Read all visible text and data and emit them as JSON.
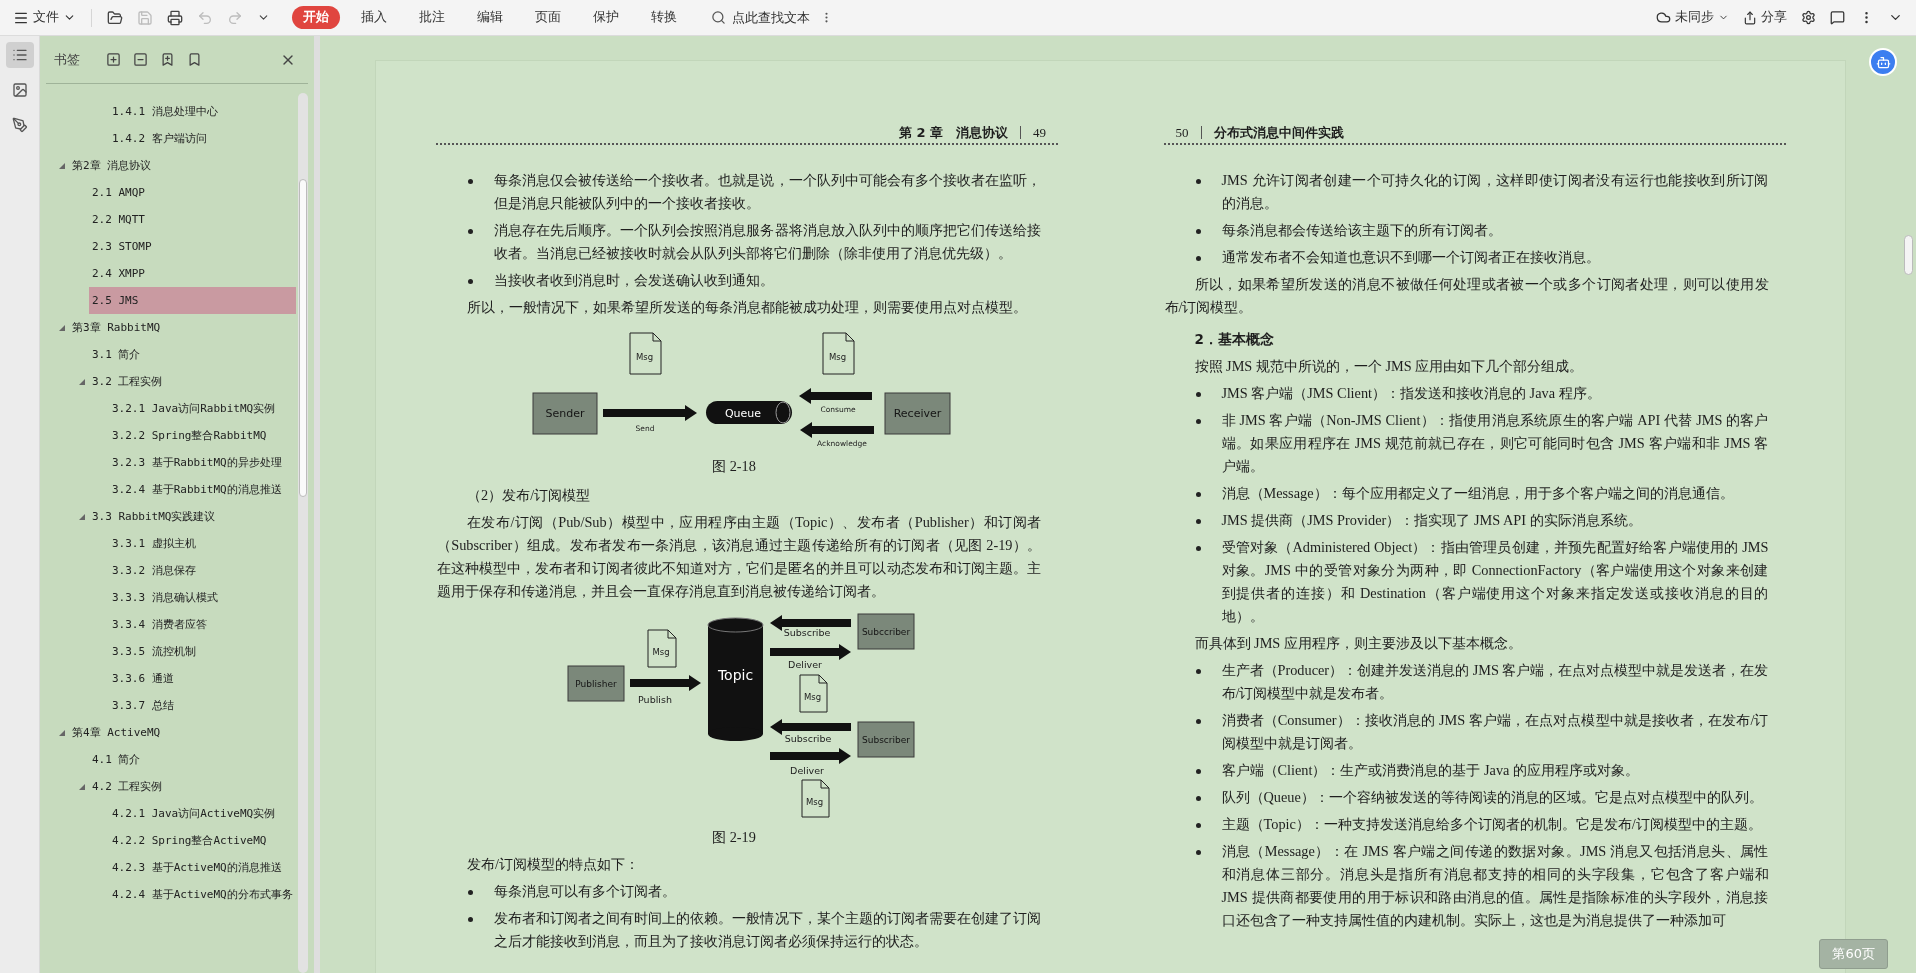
{
  "toolbar": {
    "file_menu": "文件",
    "quick_actions": [
      {
        "kind": "open",
        "disabled": false
      },
      {
        "kind": "save",
        "disabled": true
      },
      {
        "kind": "print",
        "disabled": false
      },
      {
        "kind": "undo",
        "disabled": true
      },
      {
        "kind": "redo",
        "disabled": true
      },
      {
        "kind": "more",
        "disabled": false
      }
    ],
    "tabs": [
      {
        "label": "开始",
        "selected": true
      },
      {
        "label": "插入",
        "selected": false
      },
      {
        "label": "批注",
        "selected": false
      },
      {
        "label": "编辑",
        "selected": false
      },
      {
        "label": "页面",
        "selected": false
      },
      {
        "label": "保护",
        "selected": false
      },
      {
        "label": "转换",
        "selected": false
      }
    ],
    "search": {
      "placeholder": "点此查找文本"
    },
    "sync": "未同步",
    "share": "分享"
  },
  "rail": [
    {
      "kind": "outline",
      "selected": true
    },
    {
      "kind": "images",
      "selected": false
    },
    {
      "kind": "sign",
      "selected": false
    }
  ],
  "bookmarks": {
    "title": "书签",
    "items": [
      {
        "children": [
          {
            "children": [
              {
                "label": "1.4.1 消息处理中心",
                "selected": false
              },
              {
                "label": "1.4.2 客户端访问",
                "selected": false
              }
            ]
          }
        ]
      },
      {
        "label": "第2章 消息协议",
        "expanded": true,
        "selected": false,
        "children": [
          {
            "label": "2.1 AMQP",
            "selected": false
          },
          {
            "label": "2.2 MQTT",
            "selected": false
          },
          {
            "label": "2.3 STOMP",
            "selected": false
          },
          {
            "label": "2.4 XMPP",
            "selected": false
          },
          {
            "label": "2.5 JMS",
            "selected": true
          }
        ]
      },
      {
        "label": "第3章 RabbitMQ",
        "expanded": true,
        "selected": false,
        "children": [
          {
            "label": "3.1 简介",
            "selected": false
          },
          {
            "label": "3.2 工程实例",
            "expanded": true,
            "selected": false,
            "children": [
              {
                "label": "3.2.1 Java访问RabbitMQ实例",
                "selected": false
              },
              {
                "label": "3.2.2 Spring整合RabbitMQ",
                "selected": false
              },
              {
                "label": "3.2.3 基于RabbitMQ的异步处理",
                "selected": false
              },
              {
                "label": "3.2.4 基于RabbitMQ的消息推送",
                "selected": false
              }
            ]
          },
          {
            "label": "3.3 RabbitMQ实践建议",
            "expanded": true,
            "selected": false,
            "children": [
              {
                "label": "3.3.1 虚拟主机",
                "selected": false
              },
              {
                "label": "3.3.2 消息保存",
                "selected": false
              },
              {
                "label": "3.3.3 消息确认模式",
                "selected": false
              },
              {
                "label": "3.3.4 消费者应答",
                "selected": false
              },
              {
                "label": "3.3.5 流控机制",
                "selected": false
              },
              {
                "label": "3.3.6 通道",
                "selected": false
              },
              {
                "label": "3.3.7 总结",
                "selected": false
              }
            ]
          }
        ]
      },
      {
        "label": "第4章 ActiveMQ",
        "expanded": true,
        "selected": false,
        "children": [
          {
            "label": "4.1 简介",
            "selected": false
          },
          {
            "label": "4.2 工程实例",
            "expanded": true,
            "selected": false,
            "children": [
              {
                "label": "4.2.1 Java访问ActiveMQ实例",
                "selected": false
              },
              {
                "label": "4.2.2 Spring整合ActiveMQ",
                "selected": false
              },
              {
                "label": "4.2.3 基于ActiveMQ的消息推送",
                "selected": false
              },
              {
                "label": "4.2.4 基于ActiveMQ的分布式事务",
                "selected": false
              }
            ]
          }
        ]
      }
    ]
  },
  "document": {
    "pages": [
      {
        "kind": "left",
        "header": {
          "title": "第 2 章　消息协议",
          "number": "49"
        },
        "blocks": [
          {
            "kind": "bullet",
            "text": "每条消息仅会被传送给一个接收者。也就是说，一个队列中可能会有多个接收者在监听，但是消息只能被队列中的一个接收者接收。"
          },
          {
            "kind": "bullet",
            "text": "消息存在先后顺序。一个队列会按照消息服务器将消息放入队列中的顺序把它们传送给接收者。当消息已经被接收时就会从队列头部将它们删除（除非使用了消息优先级）。"
          },
          {
            "kind": "bullet",
            "text": "当接收者收到消息时，会发送确认收到通知。"
          },
          {
            "kind": "para",
            "text": "所以，一般情况下，如果希望所发送的每条消息都能被成功处理，则需要使用点对点模型。"
          },
          {
            "kind": "queue_figure",
            "nodes": [
              "Sender",
              "Queue",
              "Receiver"
            ],
            "arrows": [
              "Send",
              "Consume",
              "Acknowledge"
            ],
            "messages": [
              "Msg",
              "Msg"
            ]
          },
          {
            "kind": "caption",
            "text": "图 2-18"
          },
          {
            "kind": "subheading",
            "text": "（2）发布/订阅模型"
          },
          {
            "kind": "para",
            "text": "在发布/订阅（Pub/Sub）模型中，应用程序由主题（Topic）、发布者（Publisher）和订阅者（Subscriber）组成。发布者发布一条消息，该消息通过主题传递给所有的订阅者（见图 2-19）。在这种模型中，发布者和订阅者彼此不知道对方，它们是匿名的并且可以动态发布和订阅主题。主题用于保存和传递消息，并且会一直保存消息直到消息被传递给订阅者。"
          },
          {
            "kind": "topic_figure",
            "nodes": [
              "Publisher",
              "Topic",
              "Subccriber",
              "Subscriber"
            ],
            "arrows": [
              "Publish",
              "Subscribe",
              "Deliver",
              "Subscribe",
              "Deliver"
            ],
            "messages": [
              "Msg",
              "Msg",
              "Msg"
            ]
          },
          {
            "kind": "caption",
            "text": "图 2-19"
          },
          {
            "kind": "para",
            "text": "发布/订阅模型的特点如下："
          },
          {
            "kind": "bullet",
            "text": "每条消息可以有多个订阅者。"
          },
          {
            "kind": "bullet",
            "text": "发布者和订阅者之间有时间上的依赖。一般情况下，某个主题的订阅者需要在创建了订阅之后才能接收到消息，而且为了接收消息订阅者必须保持运行的状态。"
          }
        ]
      },
      {
        "kind": "right",
        "header": {
          "title": "分布式消息中间件实践",
          "number": "50"
        },
        "blocks": [
          {
            "kind": "bullet",
            "text": "JMS 允许订阅者创建一个可持久化的订阅，这样即使订阅者没有运行也能接收到所订阅的消息。"
          },
          {
            "kind": "bullet",
            "text": "每条消息都会传送给该主题下的所有订阅者。"
          },
          {
            "kind": "bullet",
            "text": "通常发布者不会知道也意识不到哪一个订阅者正在接收消息。"
          },
          {
            "kind": "para",
            "text": "所以，如果希望所发送的消息不被做任何处理或者被一个或多个订阅者处理，则可以使用发布/订阅模型。"
          },
          {
            "kind": "heading",
            "text": "2．基本概念"
          },
          {
            "kind": "para",
            "text": "按照 JMS 规范中所说的，一个 JMS 应用由如下几个部分组成。"
          },
          {
            "kind": "bullet",
            "text": "JMS 客户端（JMS Client）：指发送和接收消息的 Java 程序。"
          },
          {
            "kind": "bullet",
            "text": "非 JMS 客户端（Non-JMS Client）：指使用消息系统原生的客户端 API 代替 JMS 的客户端。如果应用程序在 JMS 规范前就已存在，则它可能同时包含 JMS 客户端和非 JMS 客户端。"
          },
          {
            "kind": "bullet",
            "text": "消息（Message）：每个应用都定义了一组消息，用于多个客户端之间的消息通信。"
          },
          {
            "kind": "bullet",
            "text": "JMS 提供商（JMS Provider）：指实现了 JMS API 的实际消息系统。"
          },
          {
            "kind": "bullet",
            "text": "受管对象（Administered Object）：指由管理员创建，并预先配置好给客户端使用的 JMS 对象。JMS 中的受管对象分为两种，即 ConnectionFactory（客户端使用这个对象来创建到提供者的连接）和 Destination（客户端使用这个对象来指定发送或接收消息的目的地）。"
          },
          {
            "kind": "para",
            "text": "而具体到 JMS 应用程序，则主要涉及以下基本概念。"
          },
          {
            "kind": "bullet",
            "text": "生产者（Producer）：创建并发送消息的 JMS 客户端，在点对点模型中就是发送者，在发布/订阅模型中就是发布者。"
          },
          {
            "kind": "bullet",
            "text": "消费者（Consumer）：接收消息的 JMS 客户端，在点对点模型中就是接收者，在发布/订阅模型中就是订阅者。"
          },
          {
            "kind": "bullet",
            "text": "客户端（Client）：生产或消费消息的基于 Java 的应用程序或对象。"
          },
          {
            "kind": "bullet",
            "text": "队列（Queue）：一个容纳被发送的等待阅读的消息的区域。它是点对点模型中的队列。"
          },
          {
            "kind": "bullet",
            "text": "主题（Topic）：一种支持发送消息给多个订阅者的机制。它是发布/订阅模型中的主题。"
          },
          {
            "kind": "bullet",
            "text": "消息（Message）：在 JMS 客户端之间传递的数据对象。JMS 消息又包括消息头、属性和消息体三部分。消息头是指所有消息都支持的相同的头字段集，它包含了客户端和 JMS 提供商都要使用的用于标识和路由消息的值。属性是指除标准的头字段外，消息接口还包含了一种支持属性值的内建机制。实际上，这也是为消息提供了一种添加可"
          }
        ]
      }
    ],
    "page_badge": "第60页"
  }
}
